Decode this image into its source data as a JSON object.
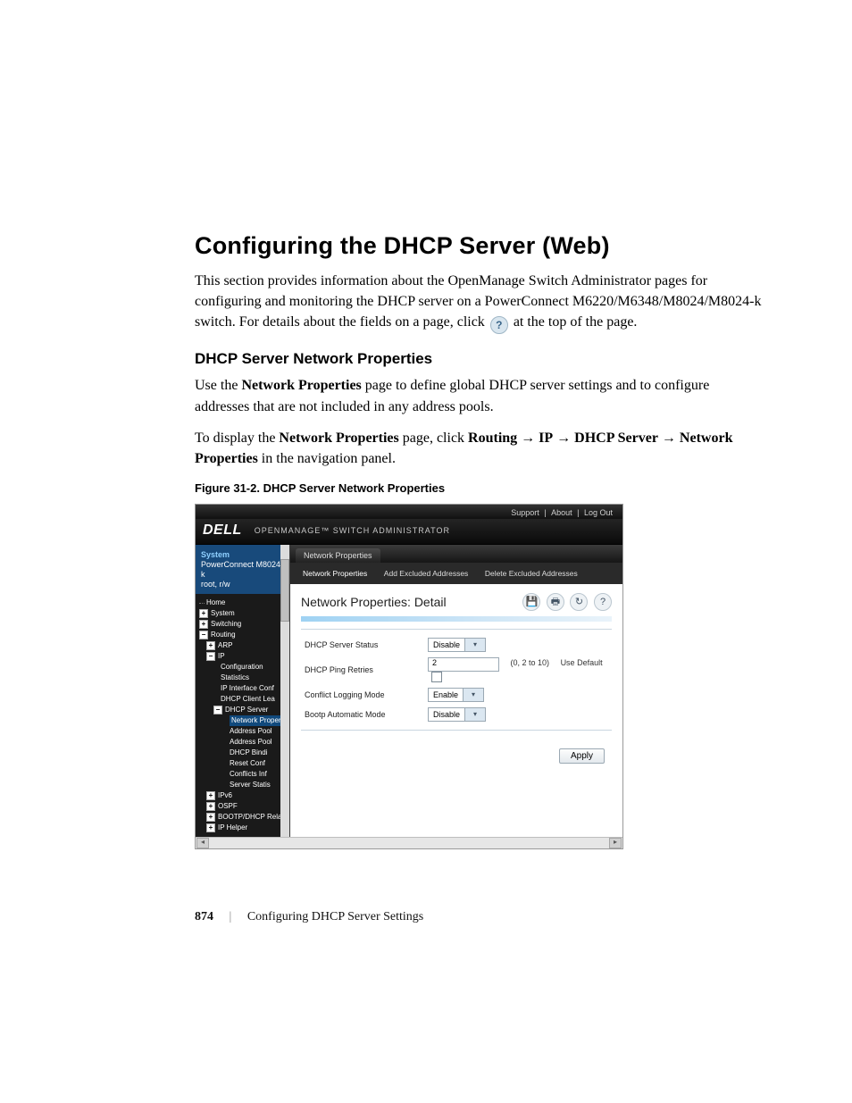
{
  "heading": "Configuring the DHCP Server (Web)",
  "intro_a": "This section provides information about the OpenManage Switch Administrator pages for configuring and monitoring the DHCP server on a PowerConnect M6220/M6348/M8024/M8024-k switch. For details about the fields on a page, click ",
  "intro_b": " at the top of the page.",
  "h2": "DHCP Server Network Properties",
  "p1a": "Use the ",
  "p1b": "Network Properties",
  "p1c": " page to define global DHCP server settings and to configure addresses that are not included in any address pools.",
  "p2a": "To display the ",
  "p2b": "Network Properties",
  "p2c": " page, click ",
  "nav": [
    "Routing",
    "IP",
    "DHCP Server",
    "Network Properties"
  ],
  "p2d": " in the navigation panel.",
  "figcap": "Figure 31-2.    DHCP Server Network Properties",
  "app": {
    "toplinks": [
      "Support",
      "About",
      "Log Out"
    ],
    "brand": "DELL",
    "suite": "OPENMANAGE™ SWITCH ADMINISTRATOR",
    "side_head_sys": "System",
    "side_head_model": "PowerConnect M8024-k",
    "side_head_user": "root, r/w",
    "tree": {
      "home": "Home",
      "system": "System",
      "switching": "Switching",
      "routing": "Routing",
      "arp": "ARP",
      "ip": "IP",
      "ip_items": [
        "Configuration",
        "Statistics",
        "IP Interface Conf",
        "DHCP Client Lea",
        "DHCP Server"
      ],
      "dhcp_items": [
        "Network Properties",
        "Address Pool",
        "Address Pool",
        "DHCP Bindi",
        "Reset Conf",
        "Conflicts Inf",
        "Server Statis"
      ],
      "ipv6": "IPv6",
      "ospf": "OSPF",
      "bdr": "BOOTP/DHCP Relay",
      "iph": "IP Helper"
    },
    "tab1": "Network Properties",
    "tabs2": [
      "Network Properties",
      "Add Excluded Addresses",
      "Delete Excluded Addresses"
    ],
    "detail_title": "Network Properties: Detail",
    "icons": {
      "save": "💾",
      "print": "🖶",
      "refresh": "↻",
      "help": "?"
    },
    "fields": {
      "r1": {
        "label": "DHCP Server Status",
        "value": "Disable"
      },
      "r2": {
        "label": "DHCP Ping Retries",
        "value": "2",
        "hint": "(0, 2 to 10)",
        "usedef": "Use Default"
      },
      "r3": {
        "label": "Conflict Logging Mode",
        "value": "Enable"
      },
      "r4": {
        "label": "Bootp Automatic Mode",
        "value": "Disable"
      }
    },
    "apply": "Apply"
  },
  "footer": {
    "page": "874",
    "chapter": "Configuring DHCP Server Settings"
  }
}
